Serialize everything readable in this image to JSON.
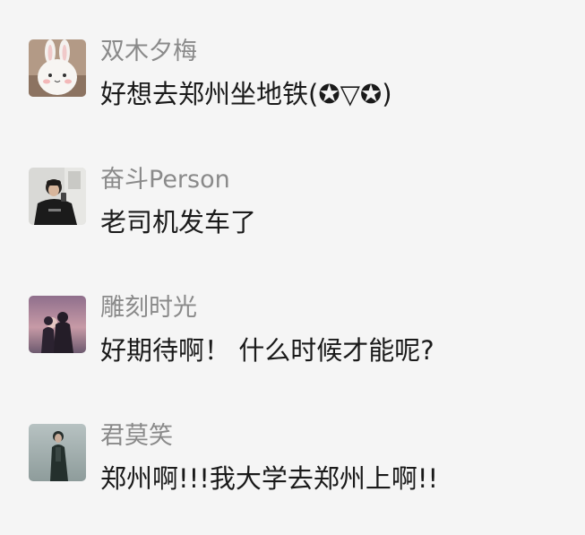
{
  "comments": [
    {
      "avatar_icon": "bunny-avatar-icon",
      "user": "双木夕梅",
      "text": "好想去郑州坐地铁(✪▽✪)"
    },
    {
      "avatar_icon": "person-photo-avatar-icon",
      "user": "奋斗Person",
      "text": "老司机发车了"
    },
    {
      "avatar_icon": "couple-sunset-avatar-icon",
      "user": "雕刻时光",
      "text": "好期待啊！ 什么时候才能呢?"
    },
    {
      "avatar_icon": "standing-person-avatar-icon",
      "user": "君莫笑",
      "text": "郑州啊!!!我大学去郑州上啊!!"
    }
  ],
  "colors": {
    "background": "#f5f5f5",
    "username": "#8a8a8a",
    "comment_text": "#1a1a1a"
  }
}
